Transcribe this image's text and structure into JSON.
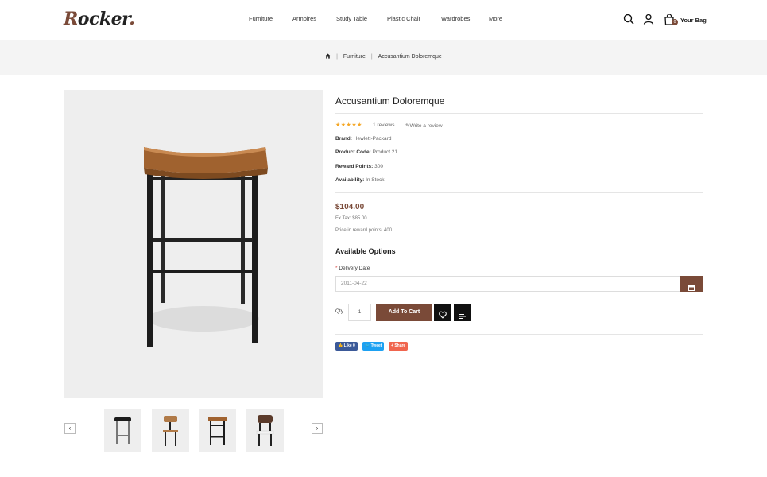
{
  "brand": {
    "logo_first": "R",
    "logo_rest": "ocker",
    "logo_dot": "."
  },
  "nav": {
    "items": [
      "Furniture",
      "Armoires",
      "Study Table",
      "Plastic Chair",
      "Wardrobes",
      "More"
    ]
  },
  "header": {
    "bag_label": "Your Bag",
    "bag_count": "0",
    "search_icon": "search-icon",
    "user_icon": "user-icon",
    "bag_icon": "shopping-bag-icon"
  },
  "breadcrumb": {
    "home_icon": "home-icon",
    "items": [
      "Furniture",
      "Accusantium Doloremque"
    ]
  },
  "product": {
    "title": "Accusantium Doloremque",
    "stars": "★★★★★",
    "reviews": "1 reviews",
    "write_review": "Write a review",
    "brand_label": "Brand:",
    "brand_value": "Hewlett-Packard",
    "code_label": "Product Code:",
    "code_value": "Product 21",
    "points_label": "Reward Points:",
    "points_value": "300",
    "availability_label": "Availability:",
    "availability_value": "In Stock",
    "price": "$104.00",
    "ex_tax": "Ex Tax: $85.00",
    "reward_price": "Price in reward points: 400"
  },
  "options": {
    "heading": "Available Options",
    "delivery_label": "Delivery Date",
    "delivery_value": "2011-04-22"
  },
  "purchase": {
    "qty_label": "Qty",
    "qty_value": "1",
    "add_to_cart": "Add To Cart"
  },
  "social": {
    "like": "Like 0",
    "tweet": "Tweet",
    "share": "Share"
  },
  "colors": {
    "accent": "#7a4a38",
    "star": "#f5a623",
    "facebook": "#3b5998",
    "twitter": "#1da1f2",
    "share": "#f0654e"
  }
}
